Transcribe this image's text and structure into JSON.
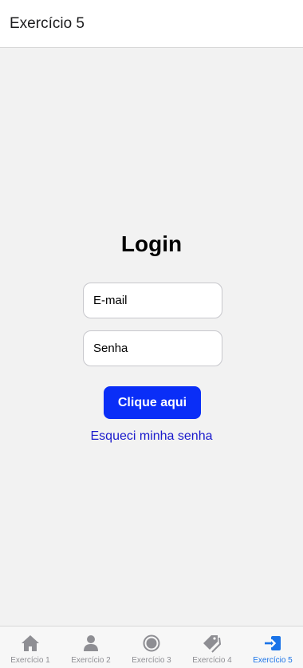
{
  "header": {
    "title": "Exercício 5"
  },
  "login": {
    "title": "Login",
    "email_placeholder": "E-mail",
    "password_placeholder": "Senha",
    "submit_label": "Clique aqui",
    "forgot_label": "Esqueci minha senha"
  },
  "colors": {
    "accent": "#0a2ef7",
    "link": "#1a1acc",
    "tab_active": "#1a73e8",
    "tab_inactive": "#8e8e93"
  },
  "tabs": [
    {
      "label": "Exercício 1",
      "icon": "home-icon",
      "active": false
    },
    {
      "label": "Exercício 2",
      "icon": "person-icon",
      "active": false
    },
    {
      "label": "Exercício 3",
      "icon": "radio-button-icon",
      "active": false
    },
    {
      "label": "Exercício 4",
      "icon": "pricetags-icon",
      "active": false
    },
    {
      "label": "Exercício 5",
      "icon": "log-in-icon",
      "active": true
    }
  ]
}
